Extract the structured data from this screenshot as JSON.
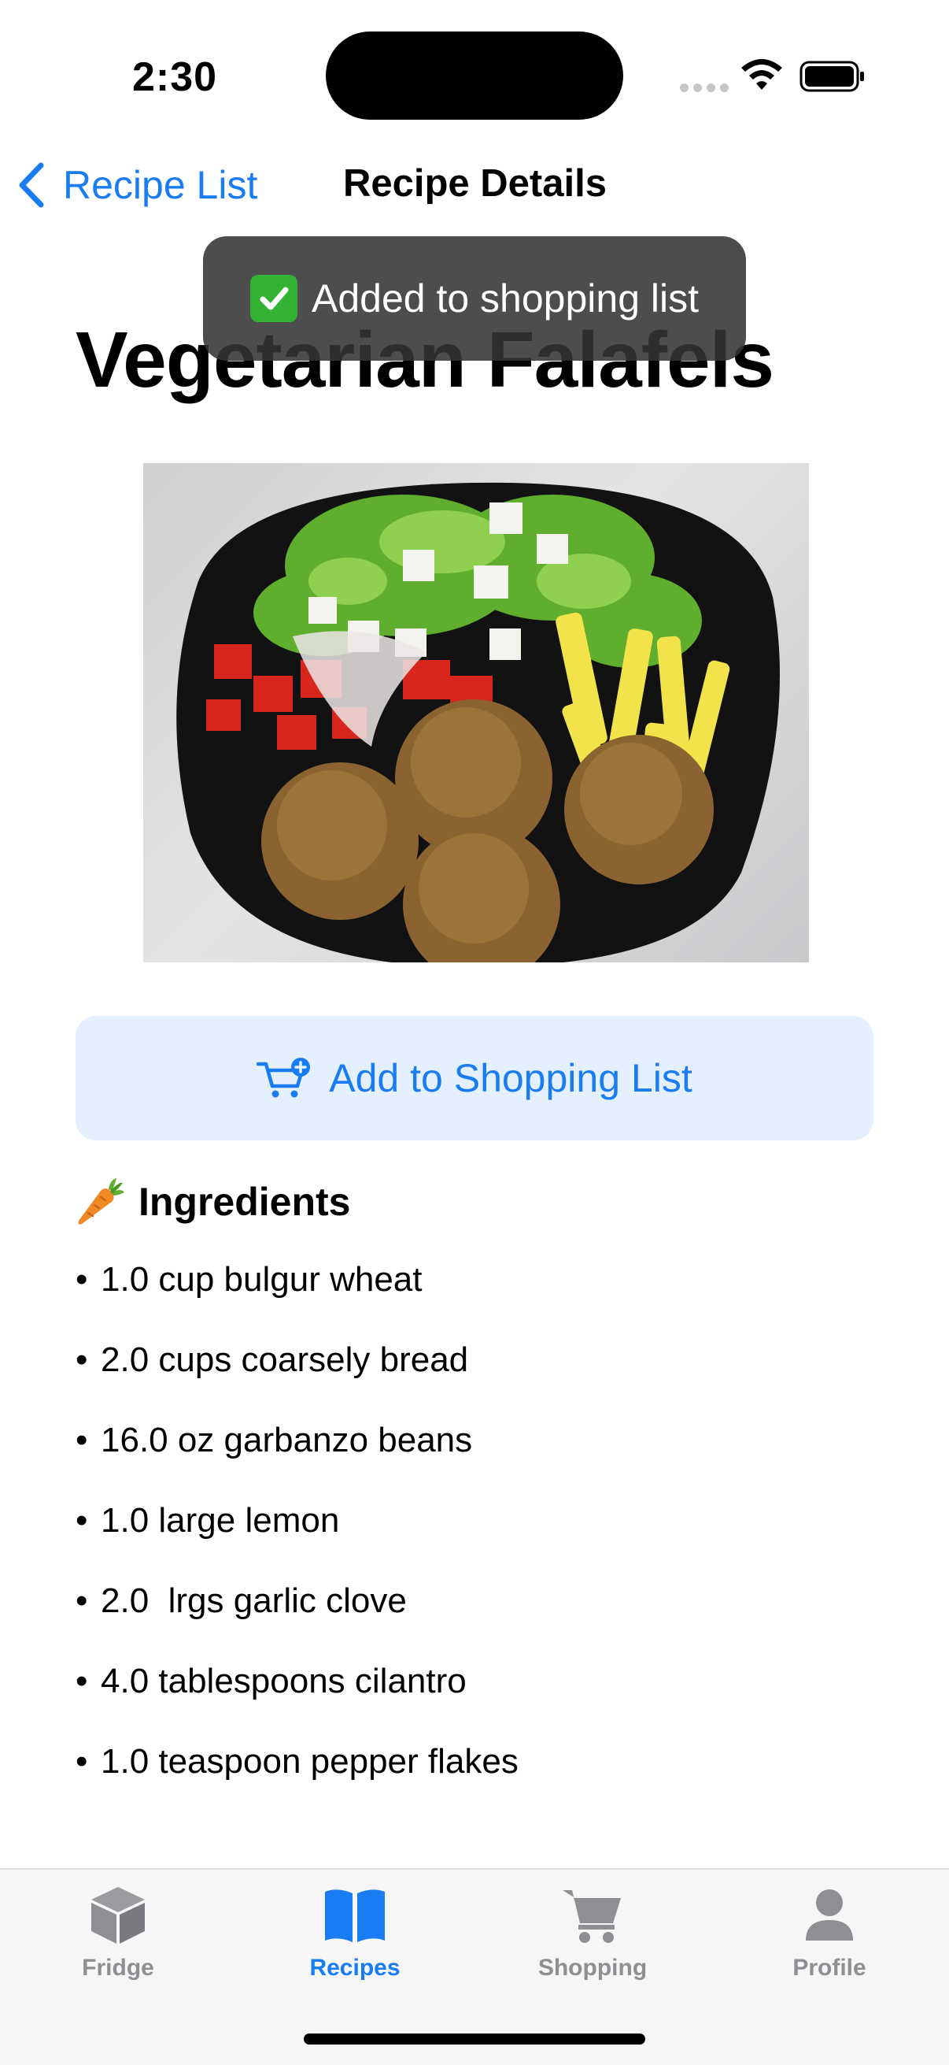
{
  "status_bar": {
    "time": "2:30"
  },
  "nav": {
    "back_label": "Recipe List",
    "title": "Recipe Details"
  },
  "toast": {
    "message": "Added to shopping list"
  },
  "recipe": {
    "title": "Vegetarian Falafels"
  },
  "actions": {
    "add_to_shopping_label": "Add to Shopping List"
  },
  "ingredients": {
    "heading": "Ingredients",
    "bullet": "•",
    "items": [
      "1.0 cup bulgur wheat",
      "2.0 cups coarsely bread",
      "16.0 oz garbanzo beans",
      "1.0 large lemon",
      "2.0  lrgs garlic clove",
      "4.0 tablespoons cilantro",
      "1.0 teaspoon pepper flakes"
    ]
  },
  "tabs": [
    {
      "label": "Fridge",
      "icon": "cube-icon",
      "active": false
    },
    {
      "label": "Recipes",
      "icon": "book-icon",
      "active": true
    },
    {
      "label": "Shopping",
      "icon": "cart-icon",
      "active": false
    },
    {
      "label": "Profile",
      "icon": "person-icon",
      "active": false
    }
  ],
  "colors": {
    "accent": "#1a7cf2",
    "button_bg": "#e4f0fd",
    "inactive_tab": "#8e8e93",
    "toast_bg": "#343434",
    "tab_bar_bg": "#f6f6f6"
  }
}
